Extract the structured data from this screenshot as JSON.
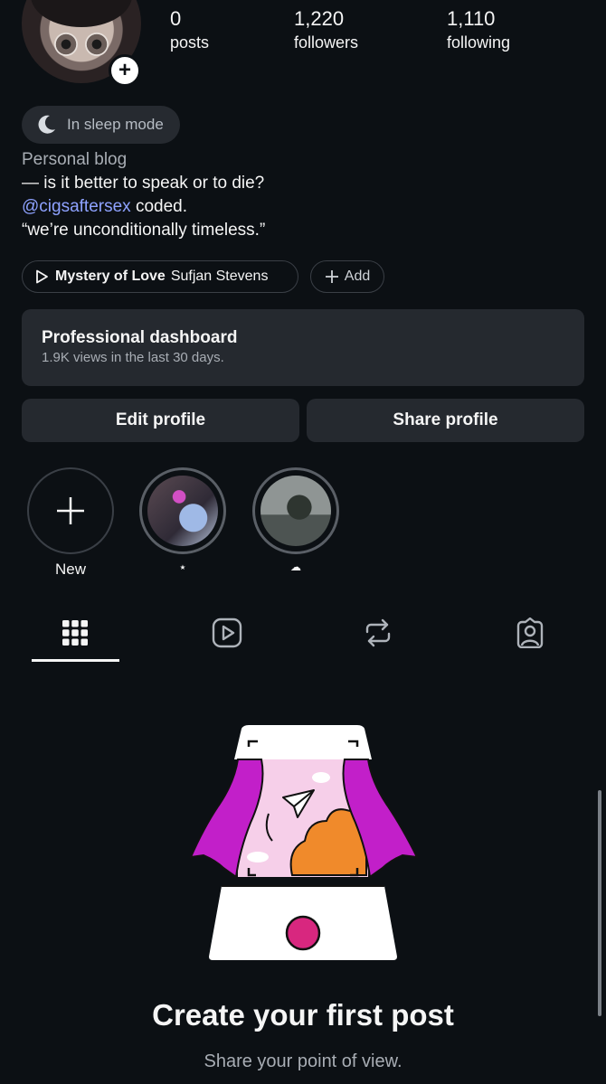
{
  "stats": [
    {
      "value": "0",
      "label": "posts"
    },
    {
      "value": "1,220",
      "label": "followers"
    },
    {
      "value": "1,110",
      "label": "following"
    }
  ],
  "status": {
    "icon": "moon-icon",
    "label": "In sleep mode"
  },
  "bio": {
    "category": "Personal blog",
    "line1": "— is it better to speak or to die?",
    "mention": "@cigsaftersex",
    "line2_suffix": " coded.",
    "line3": "“we’re unconditionally timeless.”"
  },
  "music": {
    "icon": "play-icon",
    "title": "Mystery of Love",
    "artist": "Sufjan Stevens",
    "add_label": "Add"
  },
  "dashboard": {
    "title": "Professional dashboard",
    "subtitle": "1.9K views in the last 30 days."
  },
  "actions": {
    "edit": "Edit profile",
    "share": "Share profile"
  },
  "highlights": [
    {
      "label": "New",
      "icon": "plus-icon"
    },
    {
      "label": "⭑"
    },
    {
      "label": "☁"
    }
  ],
  "tabs": [
    {
      "name": "grid",
      "icon": "grid-icon",
      "active": true
    },
    {
      "name": "reels",
      "icon": "reels-icon",
      "active": false
    },
    {
      "name": "reposts",
      "icon": "repost-icon",
      "active": false
    },
    {
      "name": "tagged",
      "icon": "tagged-icon",
      "active": false
    }
  ],
  "empty_state": {
    "title": "Create your first post",
    "subtitle": "Share your point of view."
  },
  "colors": {
    "background": "#0c1014",
    "surface": "#25292f",
    "mention": "#8ea2ff",
    "accent_magenta": "#c21fc9",
    "accent_orange": "#f08a2b"
  }
}
